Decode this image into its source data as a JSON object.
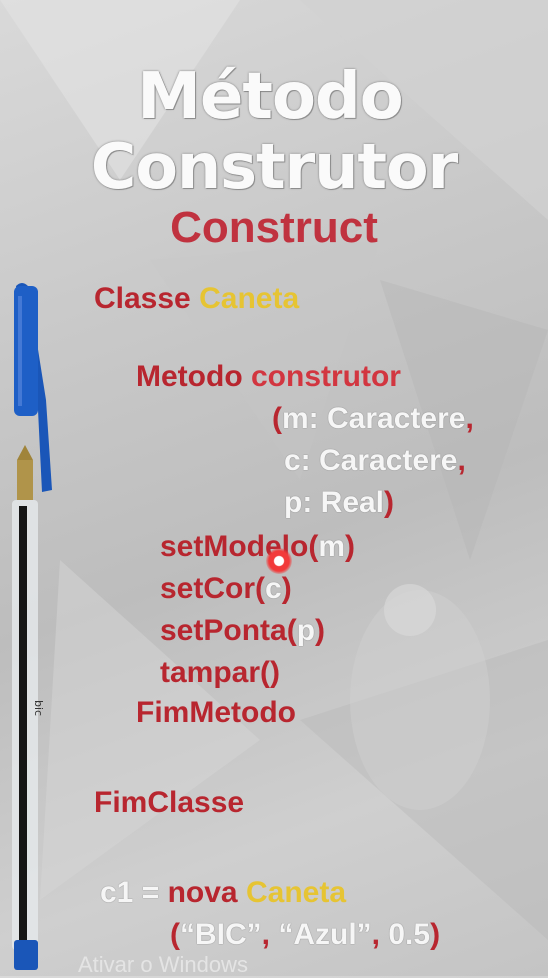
{
  "title": {
    "line1": "Método",
    "line2": "Construtor",
    "subtitle": "Construct"
  },
  "code": {
    "classe_kw": "Classe",
    "classe_name": "Caneta",
    "metodo_kw": "Metodo",
    "metodo_name": "construtor",
    "param_open": "(",
    "param1": "m: Caractere",
    "comma": ",",
    "param2": "c: Caractere",
    "param3": "p: Real",
    "param_close": ")",
    "set_modelo_fn": "setModelo",
    "set_modelo_arg": "m",
    "set_cor_fn": "setCor",
    "set_cor_arg": "c",
    "set_ponta_fn": "setPonta",
    "set_ponta_arg": "p",
    "tampar_fn": "tampar",
    "empty_parens": "()",
    "fim_metodo": "FimMetodo",
    "fim_classe": "FimClasse",
    "obj_var": "c1",
    "assign": "=",
    "nova_kw": "nova",
    "obj_class": "Caneta",
    "arg_open": "(",
    "arg1": "“BIC”",
    "arg2": "“Azul”",
    "arg3": "0.5",
    "arg_close": ")"
  },
  "watermark": "Ativar o Windows",
  "colors": {
    "keyword": "#b8262f",
    "classname": "#e6c433",
    "param": "#f6f6f6",
    "pen_cap": "#1a56b8"
  }
}
